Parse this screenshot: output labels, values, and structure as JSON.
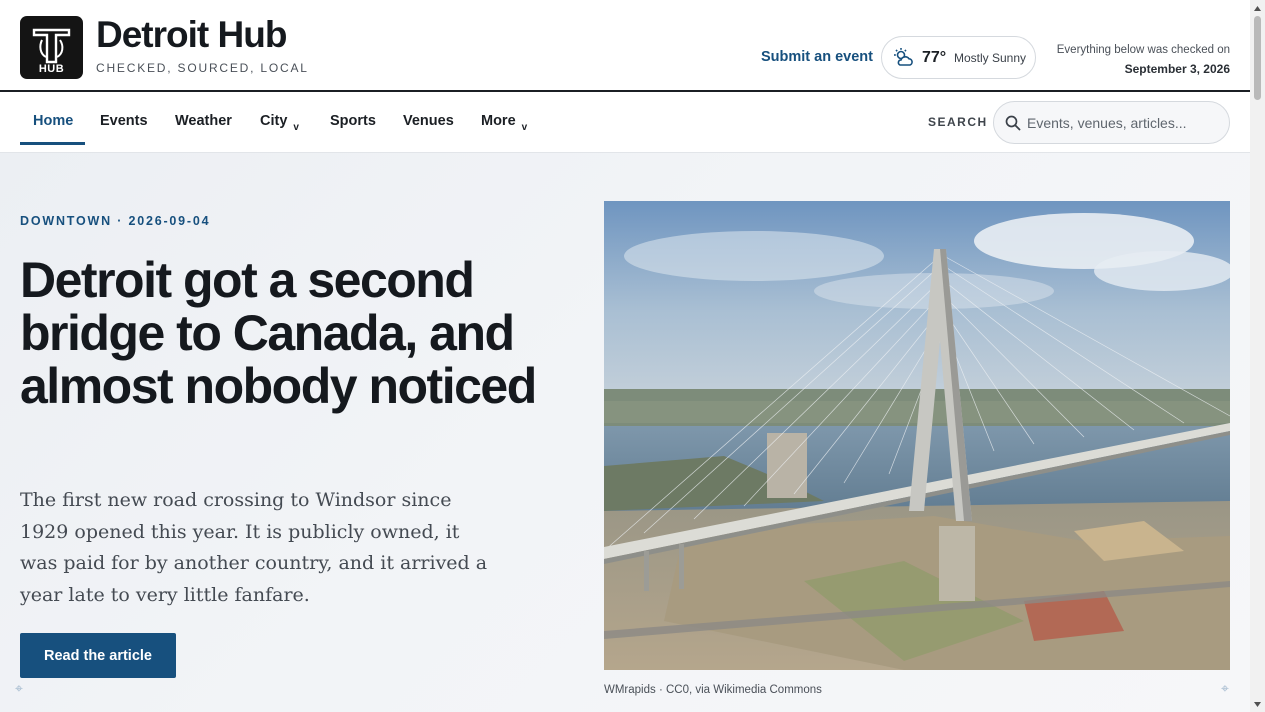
{
  "brand": {
    "title": "Detroit Hub",
    "tagline": "CHECKED, SOURCED, LOCAL",
    "logo_text": "HUB"
  },
  "header": {
    "submit_label": "Submit an event",
    "weather": {
      "icon": "partly-sunny-icon",
      "temp": "77°",
      "condition": "Mostly Sunny"
    },
    "checked_label": "Everything below was checked on",
    "checked_date": "September 3, 2026"
  },
  "nav": {
    "items": [
      {
        "label": "Home",
        "active": true
      },
      {
        "label": "Events"
      },
      {
        "label": "Weather"
      },
      {
        "label": "City",
        "dropdown": true
      },
      {
        "label": "Sports"
      },
      {
        "label": "Venues"
      },
      {
        "label": "More",
        "dropdown": true
      }
    ],
    "dropdown_glyph": "v",
    "search_label": "SEARCH",
    "search_placeholder": "Events, venues, articles..."
  },
  "hero": {
    "kicker": "DOWNTOWN · 2026-09-04",
    "headline": "Detroit got a second bridge to Canada, and almost nobody noticed",
    "dek": "The first new road crossing to Windsor since 1929 opened this year. It is publicly owned, it was paid for by another country, and it arrived a year late to very little fanfare.",
    "cta_label": "Read the article",
    "image_alt": "Aerial view of a cable-stayed bridge over the Detroit River",
    "image_credit": "WMrapids · CC0, via Wikimedia Commons"
  },
  "colors": {
    "accent": "#17507e",
    "text": "#15191e",
    "muted": "#4a5058",
    "hero_bg": "#eef1f4"
  }
}
